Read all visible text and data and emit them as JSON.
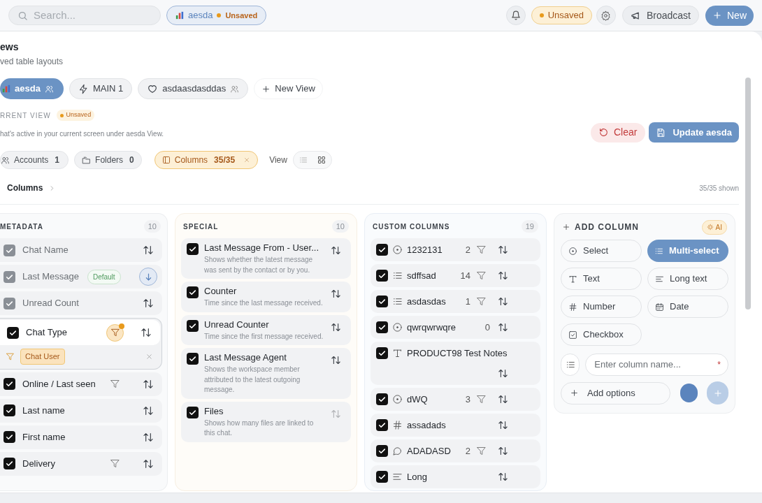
{
  "topbar": {
    "search_placeholder": "Search...",
    "view_chip": {
      "label": "aesda",
      "status": "Unsaved"
    },
    "unsaved_badge": "Unsaved",
    "broadcast": "Broadcast",
    "new_button": "New"
  },
  "header": {
    "title": "ews",
    "subtitle": "ved table layouts"
  },
  "views": [
    {
      "label": "aesda",
      "kind": "chart",
      "shared": true,
      "selected": true
    },
    {
      "label": "MAIN 1",
      "kind": "zap",
      "shared": false,
      "selected": false
    },
    {
      "label": "asdaasdasddas",
      "kind": "heart",
      "shared": true,
      "selected": false
    }
  ],
  "new_view": "New View",
  "current_view": {
    "label": "RRENT VIEW",
    "status": "Unsaved",
    "description": "hat's active in your current screen under aesda View.",
    "clear": "Clear",
    "update": "Update aesda"
  },
  "filters": [
    {
      "kind": "accounts",
      "label": "Accounts",
      "count": "1",
      "active": false
    },
    {
      "kind": "folders",
      "label": "Folders",
      "count": "0",
      "active": false
    },
    {
      "kind": "columns",
      "label": "Columns",
      "count": "35/35",
      "active": true
    }
  ],
  "view_label": "View",
  "view_modes": [
    {
      "kind": "list",
      "selected": false
    },
    {
      "kind": "grid",
      "selected": true
    }
  ],
  "breadcrumb": "Columns",
  "shown": "35/35 shown",
  "groups": [
    {
      "kind": "metadata",
      "title": "METADATA",
      "count": "10",
      "items": [
        {
          "name": "Chat Name",
          "checked": true,
          "locked": true,
          "filter": false,
          "sorted": false
        },
        {
          "name": "Last Message",
          "checked": true,
          "locked": true,
          "badge": "Default",
          "filter": false,
          "sorted": true
        },
        {
          "name": "Unread Count",
          "checked": true,
          "locked": true,
          "filter": false,
          "sorted": false
        },
        {
          "name": "Chat Type",
          "checked": true,
          "locked": false,
          "filter": true,
          "filter_active": true,
          "expanded": true,
          "filter_values": [
            "Chat User"
          ],
          "sorted": false
        },
        {
          "name": "Online / Last seen",
          "checked": true,
          "locked": false,
          "filter": true,
          "sorted": false
        },
        {
          "name": "Last name",
          "checked": true,
          "locked": false,
          "filter": false,
          "sorted": false
        },
        {
          "name": "First name",
          "checked": true,
          "locked": false,
          "filter": false,
          "sorted": false
        },
        {
          "name": "Delivery",
          "checked": true,
          "locked": false,
          "filter": true,
          "sorted": false
        }
      ]
    },
    {
      "kind": "special",
      "title": "SPECIAL",
      "count": "10",
      "items": [
        {
          "name": "Last Message From - User...",
          "description": "Shows whether the latest message was sent by the contact or by you.",
          "checked": true,
          "sortable": true
        },
        {
          "name": "Counter",
          "description": "Time since the last message received.",
          "checked": true,
          "sortable": true
        },
        {
          "name": "Unread Counter",
          "description": "Time since the first message received.",
          "checked": true,
          "sortable": true
        },
        {
          "name": "Last Message Agent",
          "description": "Shows the workspace member attributed to the latest outgoing message.",
          "checked": true,
          "sortable": true
        },
        {
          "name": "Files",
          "description": "Shows how many files are linked to this chat.",
          "checked": true,
          "sortable": false
        }
      ]
    },
    {
      "kind": "custom",
      "title": "CUSTOM COLUMNS",
      "count": "19",
      "items": [
        {
          "name": "1232131",
          "kind": "select",
          "count": "2",
          "filter": true,
          "checked": true
        },
        {
          "name": "sdffsad",
          "kind": "multi",
          "count": "14",
          "filter": true,
          "checked": true
        },
        {
          "name": "asdasdas",
          "kind": "multi",
          "count": "1",
          "filter": true,
          "checked": true
        },
        {
          "name": "qwrqwrwqre",
          "kind": "select",
          "count": "0",
          "filter": false,
          "checked": true
        },
        {
          "name": "PRODUCT98 Test Notes",
          "kind": "text",
          "filter": false,
          "checked": true
        },
        {
          "name": "dWQ",
          "kind": "select",
          "count": "3",
          "filter": true,
          "checked": true
        },
        {
          "name": "assadads",
          "kind": "number",
          "filter": false,
          "checked": true
        },
        {
          "name": "ADADASD",
          "kind": "chat",
          "count": "2",
          "filter": true,
          "checked": true
        },
        {
          "name": "Long",
          "kind": "long",
          "filter": false,
          "checked": true
        }
      ]
    }
  ],
  "add_column": {
    "title": "ADD COLUMN",
    "ai": "AI",
    "types": [
      {
        "kind": "select",
        "label": "Select",
        "selected": false
      },
      {
        "kind": "multi",
        "label": "Multi-select",
        "selected": true
      },
      {
        "kind": "text",
        "label": "Text",
        "selected": false
      },
      {
        "kind": "long",
        "label": "Long text",
        "selected": false
      },
      {
        "kind": "number",
        "label": "Number",
        "selected": false
      },
      {
        "kind": "date",
        "label": "Date",
        "selected": false
      },
      {
        "kind": "checkbox",
        "label": "Checkbox",
        "selected": false
      }
    ],
    "name_placeholder": "Enter column name...",
    "required_mark": "*",
    "add_options": "Add options"
  }
}
